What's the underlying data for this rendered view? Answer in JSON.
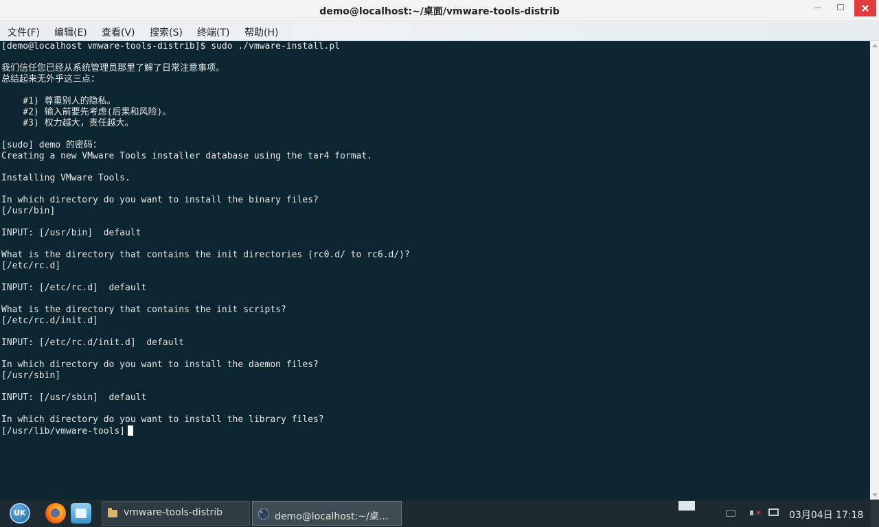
{
  "window": {
    "title": "demo@localhost:~/桌面/vmware-tools-distrib"
  },
  "menu": {
    "items": [
      "文件(F)",
      "编辑(E)",
      "查看(V)",
      "搜索(S)",
      "终端(T)",
      "帮助(H)"
    ]
  },
  "terminal": {
    "lines": [
      "[demo@localhost vmware-tools-distrib]$ sudo ./vmware-install.pl",
      "",
      "我们信任您已经从系统管理员那里了解了日常注意事项。",
      "总结起来无外乎这三点：",
      "",
      "    #1) 尊重别人的隐私。",
      "    #2) 输入前要先考虑(后果和风险)。",
      "    #3) 权力越大，责任越大。",
      "",
      "[sudo] demo 的密码：",
      "Creating a new VMware Tools installer database using the tar4 format.",
      "",
      "Installing VMware Tools.",
      "",
      "In which directory do you want to install the binary files?",
      "[/usr/bin]",
      "",
      "INPUT: [/usr/bin]  default",
      "",
      "What is the directory that contains the init directories (rc0.d/ to rc6.d/)?",
      "[/etc/rc.d]",
      "",
      "INPUT: [/etc/rc.d]  default",
      "",
      "What is the directory that contains the init scripts?",
      "[/etc/rc.d/init.d]",
      "",
      "INPUT: [/etc/rc.d/init.d]  default",
      "",
      "In which directory do you want to install the daemon files?",
      "[/usr/sbin]",
      "",
      "INPUT: [/usr/sbin]  default",
      "",
      "In which directory do you want to install the library files?",
      "[/usr/lib/vmware-tools]"
    ]
  },
  "taskbar": {
    "tasks": [
      {
        "label": "vmware-tools-distrib",
        "icon": "folder-icon"
      },
      {
        "label": "demo@localhost:~/桌…",
        "icon": "terminal-icon"
      }
    ],
    "clock": "03月04日 17:18"
  },
  "colors": {
    "terminal_bg": "#0b2630",
    "terminal_fg": "#e8e8e8",
    "close_button": "#e13d3d",
    "taskbar_bg": "#1e2a31"
  }
}
